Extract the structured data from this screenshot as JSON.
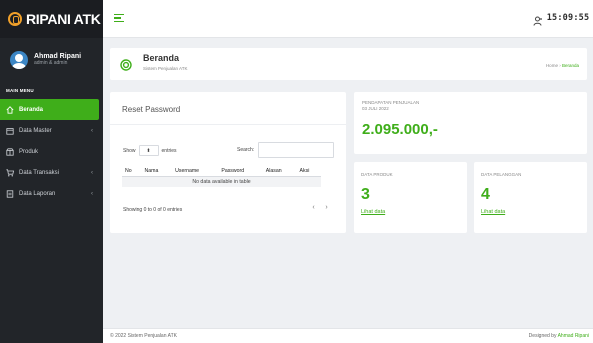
{
  "brand": {
    "name": "RIPANI ATK"
  },
  "user": {
    "name": "Ahmad Ripani",
    "role": "admin & admin"
  },
  "sidebar": {
    "menu_title": "MAIN MENU",
    "items": [
      {
        "label": "Beranda",
        "icon": "home-icon",
        "active": true
      },
      {
        "label": "Data Master",
        "icon": "folder-icon",
        "caret": "‹"
      },
      {
        "label": "Produk",
        "icon": "box-icon"
      },
      {
        "label": "Data Transaksi",
        "icon": "cart-icon",
        "caret": "‹"
      },
      {
        "label": "Data Laporan",
        "icon": "report-icon",
        "caret": "‹"
      }
    ]
  },
  "topbar": {
    "clock": "15:09:55"
  },
  "page_header": {
    "title": "Beranda",
    "subtitle": "Sistem Penjualan ATK",
    "breadcrumb": {
      "home": "Home",
      "separator": "›",
      "current": "Beranda"
    }
  },
  "reset_card": {
    "title": "Reset Password",
    "show_label": "Show",
    "entries_label": "entries",
    "select_value": "⬍",
    "search_label": "Search:",
    "columns": [
      "No",
      "Nama",
      "Username",
      "Password",
      "Alasan",
      "Aksi"
    ],
    "empty_text": "No data available in table",
    "info": "Showing 0 to 0 of 0 entries",
    "prev": "‹",
    "next": "›"
  },
  "sales_card": {
    "label": "PENDAPATAN PENJUALAN",
    "date": "03 JULI 2022",
    "value": "2.095.000,-"
  },
  "produk_card": {
    "label": "DATA PRODUK",
    "value": "3",
    "link": "Lihat data"
  },
  "pelanggan_card": {
    "label": "DATA PELANGGAN",
    "value": "4",
    "link": "Lihat data"
  },
  "footer": {
    "left": "© 2022 Sistem Penjualan ATK",
    "right_prefix": "Designed by",
    "author": "Ahmad Ripani"
  },
  "colors": {
    "accent": "#3fae1a",
    "sidebar": "#222529",
    "background": "#eef0f3"
  }
}
